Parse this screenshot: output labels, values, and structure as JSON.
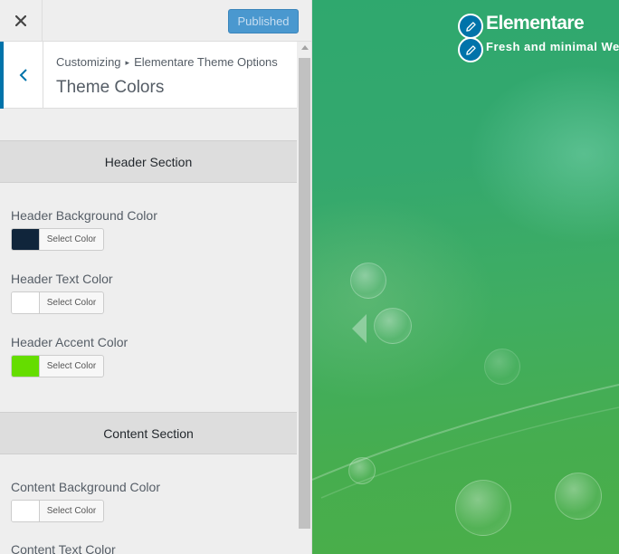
{
  "topbar": {
    "close_icon": "close-icon",
    "publish_label": "Published"
  },
  "header": {
    "breadcrumb_root": "Customizing",
    "breadcrumb_separator": "▸",
    "breadcrumb_parent": "Elementare Theme Options",
    "title": "Theme Colors",
    "back_icon": "chevron-left-icon"
  },
  "groups": [
    {
      "heading": "Header Section",
      "controls": [
        {
          "label": "Header Background Color",
          "button": "Select Color",
          "color": "#10253b"
        },
        {
          "label": "Header Text Color",
          "button": "Select Color",
          "color": "#ffffff"
        },
        {
          "label": "Header Accent Color",
          "button": "Select Color",
          "color": "#65dd00"
        }
      ]
    },
    {
      "heading": "Content Section",
      "controls": [
        {
          "label": "Content Background Color",
          "button": "Select Color",
          "color": "#ffffff"
        },
        {
          "label": "Content Text Color"
        }
      ]
    }
  ],
  "preview": {
    "site_title": "Elementare",
    "site_tagline": "Fresh and minimal We",
    "edit_icon": "pencil-icon"
  },
  "colors": {
    "accent": "#0073aa",
    "publish_bg": "#4a98cf"
  }
}
